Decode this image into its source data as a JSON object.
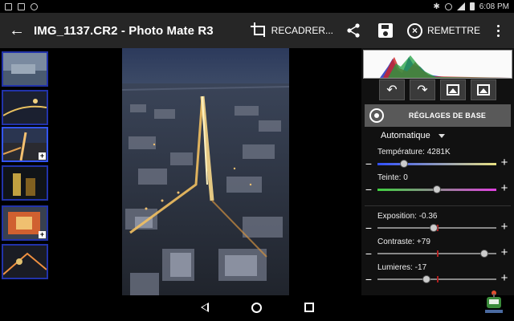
{
  "status_bar": {
    "time": "6:08 PM"
  },
  "toolbar": {
    "title": "IMG_1137.CR2 - Photo Mate R3",
    "crop_label": "RECADRER...",
    "reset_label": "REMETTRE"
  },
  "panel": {
    "base_settings_label": "RÉGLAGES DE BASE",
    "preset_dropdown": "Automatique",
    "sliders": [
      {
        "label": "Température: 4281K",
        "value": 0.22,
        "track": "temperature"
      },
      {
        "label": "Teinte: 0",
        "value": 0.5,
        "track": "tint"
      },
      {
        "label": "Exposition: -0.36",
        "value": 0.47,
        "track": "gray"
      },
      {
        "label": "Contraste: +79",
        "value": 0.9,
        "track": "gray"
      },
      {
        "label": "Lumieres: -17",
        "value": 0.41,
        "track": "gray"
      }
    ]
  },
  "filmstrip": {
    "thumbnails": [
      {
        "selected": false,
        "badge": ""
      },
      {
        "selected": false,
        "badge": ""
      },
      {
        "selected": true,
        "badge": "+"
      },
      {
        "selected": false,
        "badge": ""
      },
      {
        "selected": false,
        "badge": "+"
      },
      {
        "selected": false,
        "badge": ""
      }
    ]
  },
  "colors": {
    "toolbar_bg": "#262626",
    "panel_bg": "#111111",
    "accent_blue": "#3355ff",
    "button_bg": "#595959"
  }
}
